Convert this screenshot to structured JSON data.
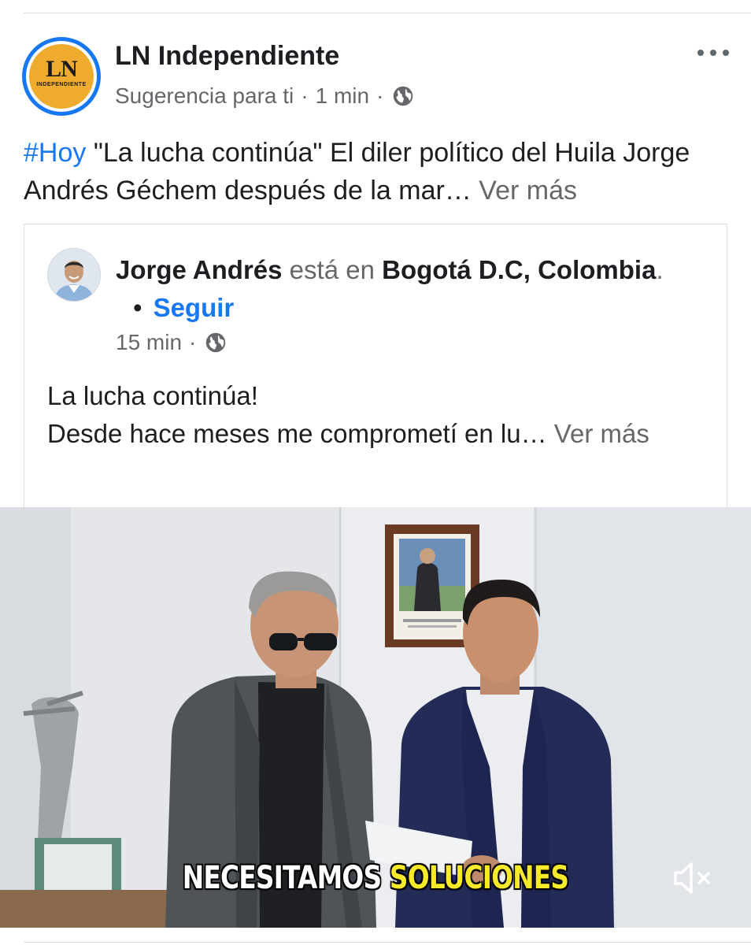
{
  "post": {
    "page_name": "LN Independiente",
    "avatar_text": "LN",
    "avatar_subtext": "INDEPENDIENTE",
    "meta": {
      "label": "Sugerencia para ti",
      "separator": "·",
      "time": "1 min",
      "audience_icon": "globe-icon"
    },
    "more_icon": "more-dots-icon",
    "text": {
      "hashtag": "#Hoy",
      "body": " \"La lucha continúa\" El diler político del Huila Jorge Andrés Géchem después de la mar…",
      "see_more": " Ver más"
    }
  },
  "shared": {
    "author": "Jorge Andrés",
    "verb": " está en ",
    "location": "Bogotá D.C, Colombia",
    "period": ".",
    "bullet": "•",
    "follow_label": "Seguir",
    "time": "15 min",
    "separator": "·",
    "audience_icon": "globe-icon",
    "text_line1": "La lucha continúa!",
    "text_line2": "Desde hace meses me comprometí en lu…",
    "see_more": " Ver más"
  },
  "video": {
    "caption_white": "NECESITAMOS ",
    "caption_yellow": "SOLUCIONES",
    "mute_icon": "speaker-muted-icon"
  },
  "colors": {
    "accent_blue": "#1877f2",
    "muted_text": "#65676b",
    "avatar_gold": "#efab2e",
    "caption_yellow": "#f7ea2a"
  }
}
